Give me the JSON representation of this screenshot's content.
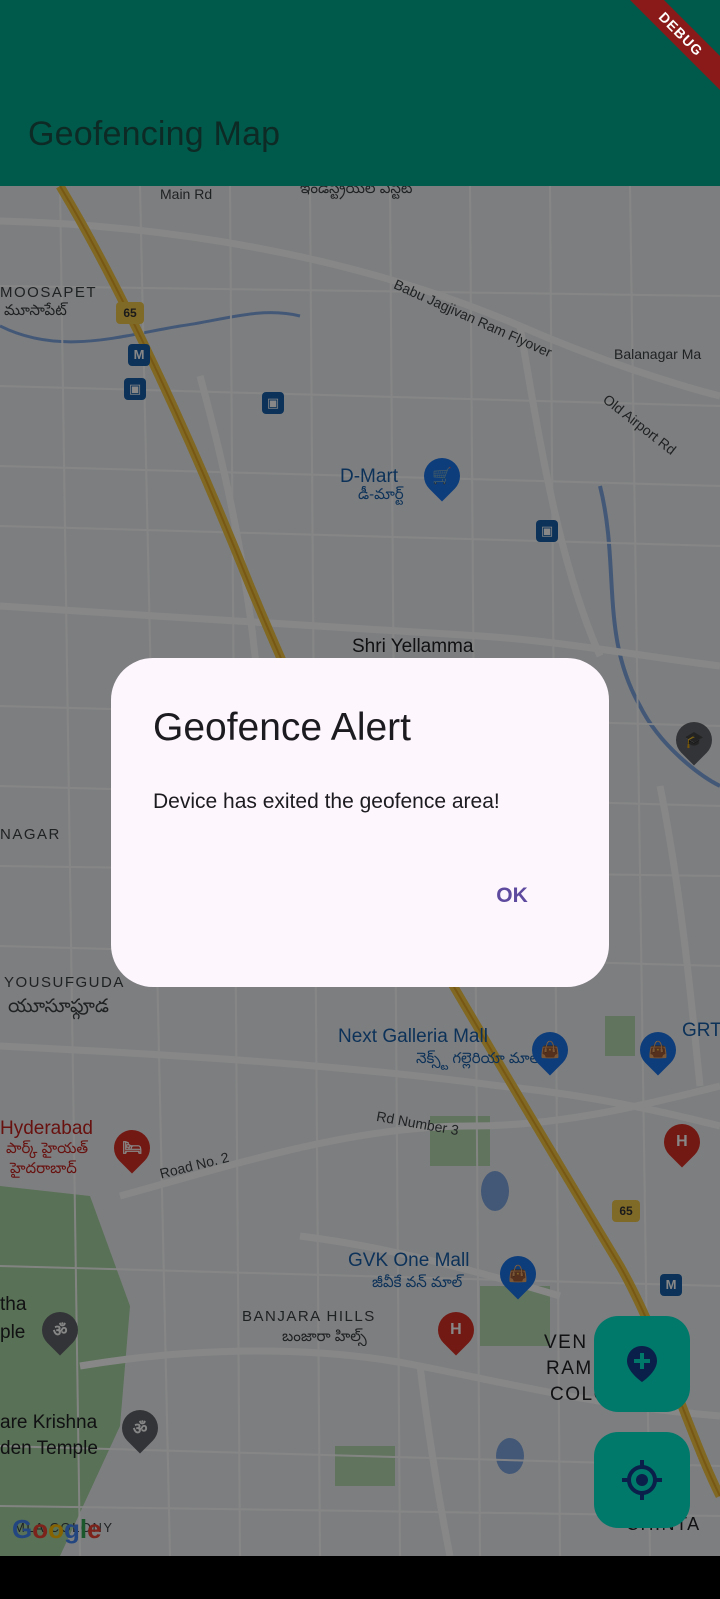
{
  "app_bar": {
    "title": "Geofencing Map",
    "debug_banner": "DEBUG",
    "color": "#005a4c"
  },
  "map": {
    "labels": {
      "main_rd": "Main Rd",
      "telugu_top": "ఇండస్ట్రియల్ ఎస్టేట్",
      "moosapet": "MOOSAPET",
      "moosapet_te": "మూసాపేట్",
      "babu_flyover": "Babu Jagjivan Ram Flyover",
      "balanagar": "Balanagar Ma",
      "old_airport": "Old Airport Rd",
      "dmart": "D-Mart",
      "dmart_te": "డీ-మార్ట్",
      "shri_yellamma": "Shri Yellamma",
      "nagar": "NAGAR",
      "yousufguda": "YOUSUFGUDA",
      "yousufguda_te": "యూసూఫ్గూడ",
      "next_galleria": "Next Galleria Mall",
      "next_galleria_te": "నెక్స్ట్ గల్లెరియా మాల్",
      "grt": "GRT",
      "hyderabad": "Hyderabad",
      "park_hyatt_te": "పార్క్ హైయత్",
      "hyderabad_te": "హైదరాబాద్",
      "rd_number_3": "Rd Number 3",
      "road_no_2": "Road No. 2",
      "gvk_one_mall": "GVK One Mall",
      "gvk_one_mall_te": "జీవీకే వన్ మాల్",
      "banjara_hills": "BANJARA HILLS",
      "banjara_hills_te": "బంజారా హిల్స్",
      "colony": "COLONY",
      "ven": "VEN",
      "ram": "RAM",
      "krishna_temple": "are Krishna",
      "krishna_temple_2": "den Temple",
      "tha": "tha",
      "ple": "ple",
      "mla_colony": "MLA COLONY",
      "chinta": "CHINTA",
      "route_65": "65",
      "metro": "M"
    },
    "google_logo": [
      "G",
      "o",
      "o",
      "g",
      "l",
      "e"
    ]
  },
  "dialog": {
    "title": "Geofence Alert",
    "content": "Device has exited the geofence area!",
    "ok_label": "OK",
    "background": "#fdf6fd",
    "action_color": "#5e4a9e"
  },
  "fabs": {
    "add_geofence_icon": "add-location-icon",
    "my_location_icon": "my-location-icon",
    "color": "#00796b"
  }
}
